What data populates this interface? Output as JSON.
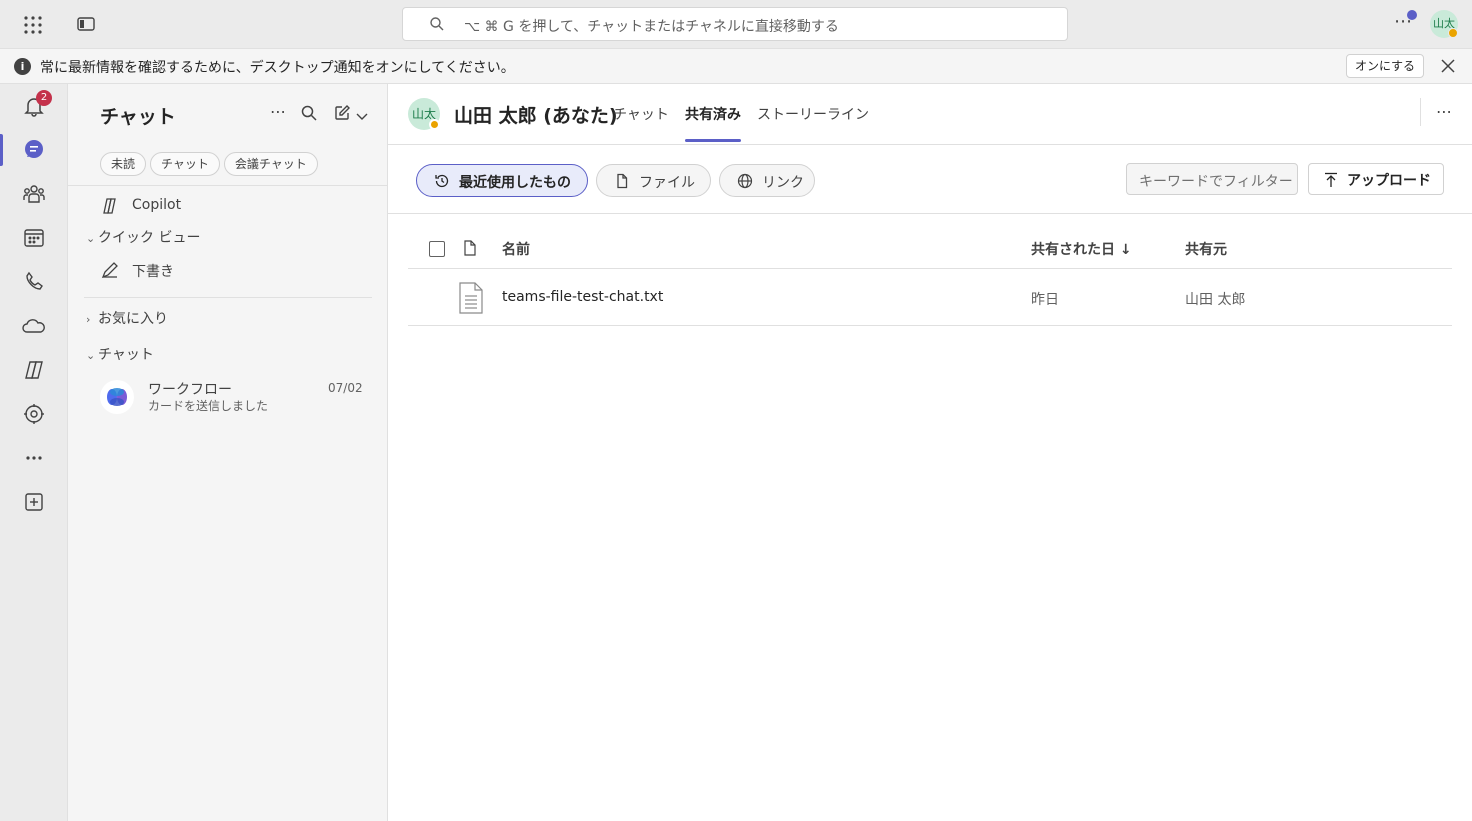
{
  "topbar": {
    "search_placeholder": "⌥ ⌘ G を押して、チャットまたはチャネルに直接移動する",
    "more": "⋯",
    "avatar_initials": "山太"
  },
  "notice": {
    "info": "i",
    "text": "常に最新情報を確認するために、デスクトップ通知をオンにしてください。",
    "button": "オンにする"
  },
  "rail": {
    "activity_badge": "2",
    "items": [
      "bell-icon",
      "chat-icon",
      "teams-icon",
      "calendar-icon",
      "calls-icon",
      "onedrive-icon",
      "copilot-icon",
      "apps-icon",
      "more-icon",
      "add-app-icon"
    ]
  },
  "chatpane": {
    "title": "チャット",
    "more": "⋯",
    "filters": [
      "未読",
      "チャット",
      "会議チャット"
    ],
    "copilot": "Copilot",
    "quick_view": "クイック ビュー",
    "drafts": "下書き",
    "favorites": "お気に入り",
    "chats_section": "チャット",
    "chat_item": {
      "name": "ワークフロー",
      "preview": "カードを送信しました",
      "date": "07/02"
    }
  },
  "main": {
    "avatar_initials": "山太",
    "title": "山田 太郎 (あなた)",
    "tabs": [
      "チャット",
      "共有済み",
      "ストーリーライン"
    ],
    "active_tab": "共有済み",
    "more": "⋯",
    "pills": [
      "最近使用したもの",
      "ファイル",
      "リンク"
    ],
    "filter_placeholder": "キーワードでフィルター",
    "upload": "アップロード",
    "columns": {
      "name": "名前",
      "shared_date": "共有された日",
      "shared_by": "共有元"
    },
    "rows": [
      {
        "name": "teams-file-test-chat.txt",
        "shared_date": "昨日",
        "shared_by": "山田 太郎"
      }
    ]
  },
  "colors": {
    "accent": "#5b5fc7",
    "badge": "#c4314b",
    "presence_away": "#eaa300"
  }
}
